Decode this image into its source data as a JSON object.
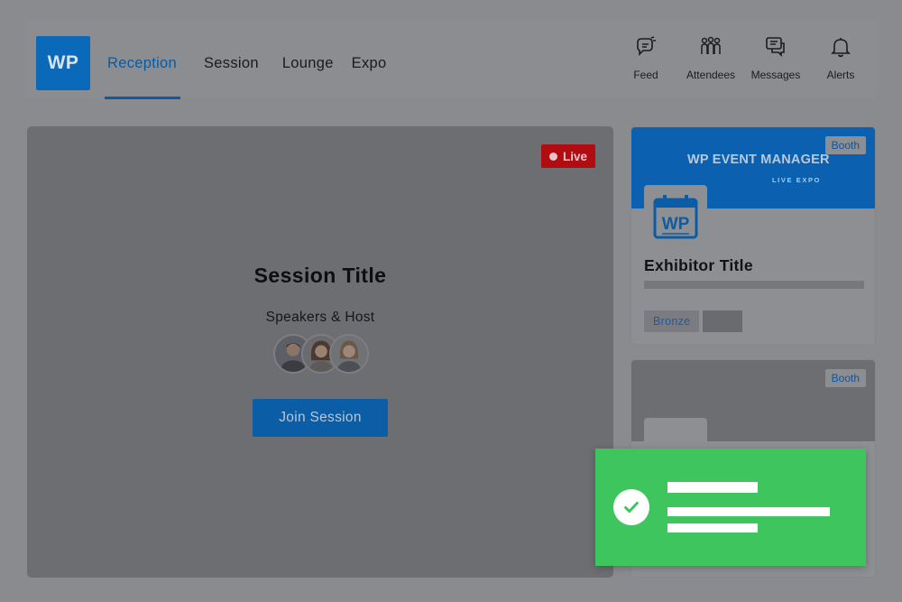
{
  "header": {
    "logo_text": "WP",
    "nav": [
      {
        "label": "Reception",
        "active": true
      },
      {
        "label": "Session",
        "active": false
      },
      {
        "label": "Lounge",
        "active": false
      },
      {
        "label": "Expo",
        "active": false
      }
    ],
    "tools": [
      {
        "label": "Feed",
        "icon": "feed-icon"
      },
      {
        "label": "Attendees",
        "icon": "attendees-icon"
      },
      {
        "label": "Messages",
        "icon": "messages-icon"
      },
      {
        "label": "Alerts",
        "icon": "bell-icon"
      }
    ]
  },
  "session": {
    "live_label": "Live",
    "title": "Session Title",
    "speakers_label": "Speakers & Host",
    "join_label": "Join Session"
  },
  "booths": [
    {
      "badge": "Booth",
      "banner_brand": "WP EVENT MANAGER",
      "banner_sub": "LIVE EXPO",
      "logo_text": "WP",
      "title": "Exhibitor Title",
      "tier": "Bronze"
    },
    {
      "badge": "Booth"
    }
  ],
  "colors": {
    "accent": "#0c5aa0",
    "live": "#b10c12",
    "toast": "#3ec55e"
  }
}
